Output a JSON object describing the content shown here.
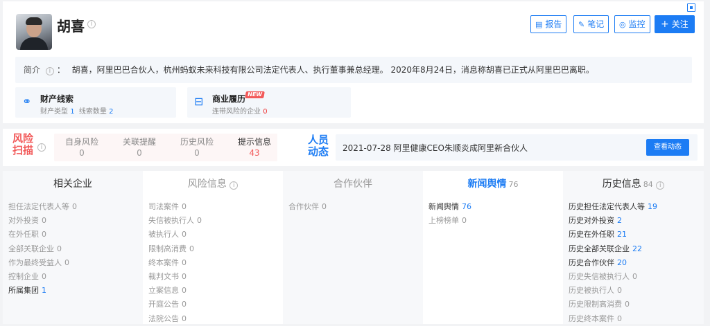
{
  "person": {
    "name": "胡喜"
  },
  "actions": {
    "report": "报告",
    "notes": "笔记",
    "monitor": "监控",
    "follow": "关注"
  },
  "intro": {
    "label": "简介",
    "text": "胡喜，阿里巴巴合伙人，杭州蚂蚁未来科技有限公司法定代表人、执行董事兼总经理。 2020年8月24日，消息称胡喜已正式从阿里巴巴离职。"
  },
  "cards": [
    {
      "title": "财产线索",
      "sub1_label": "财产类型",
      "sub1_value": "1",
      "sub2_label": "线索数量",
      "sub2_value": "2",
      "icon": "link-icon"
    },
    {
      "title": "商业履历",
      "badge": "NEW",
      "sub_label": "连带风险的企业",
      "sub_value": "0",
      "icon": "briefcase-icon"
    }
  ],
  "risk": {
    "title_line1": "风险",
    "title_line2": "扫描",
    "items": [
      {
        "label": "自身风险",
        "value": "0"
      },
      {
        "label": "关联提醒",
        "value": "0"
      },
      {
        "label": "历史风险",
        "value": "0"
      },
      {
        "label": "提示信息",
        "value": "43"
      }
    ]
  },
  "dynamics": {
    "title_line1": "人员",
    "title_line2": "动态",
    "text": "2021-07-28 阿里健康CEO朱顺炎成阿里新合伙人",
    "button": "查看动态"
  },
  "tabs": [
    {
      "label": "相关企业",
      "count": "",
      "rows": [
        {
          "label": "担任法定代表人等",
          "value": "0"
        },
        {
          "label": "对外投资",
          "value": "0"
        },
        {
          "label": "在外任职",
          "value": "0"
        },
        {
          "label": "全部关联企业",
          "value": "0"
        },
        {
          "label": "作为最终受益人",
          "value": "0"
        },
        {
          "label": "控制企业",
          "value": "0"
        },
        {
          "label": "所属集团",
          "value": "1"
        }
      ]
    },
    {
      "label": "风险信息",
      "count": "",
      "rows": [
        {
          "label": "司法案件",
          "value": "0"
        },
        {
          "label": "失信被执行人",
          "value": "0"
        },
        {
          "label": "被执行人",
          "value": "0"
        },
        {
          "label": "限制高消费",
          "value": "0"
        },
        {
          "label": "终本案件",
          "value": "0"
        },
        {
          "label": "裁判文书",
          "value": "0"
        },
        {
          "label": "立案信息",
          "value": "0"
        },
        {
          "label": "开庭公告",
          "value": "0"
        },
        {
          "label": "法院公告",
          "value": "0"
        }
      ]
    },
    {
      "label": "合作伙伴",
      "count": "",
      "rows": [
        {
          "label": "合作伙伴",
          "value": "0"
        }
      ]
    },
    {
      "label": "新闻舆情",
      "count": "76",
      "rows": [
        {
          "label": "新闻舆情",
          "value": "76"
        },
        {
          "label": "上榜榜单",
          "value": "0"
        }
      ]
    },
    {
      "label": "历史信息",
      "count": "84",
      "rows": [
        {
          "label": "历史担任法定代表人等",
          "value": "19"
        },
        {
          "label": "历史对外投资",
          "value": "2"
        },
        {
          "label": "历史在外任职",
          "value": "21"
        },
        {
          "label": "历史全部关联企业",
          "value": "22"
        },
        {
          "label": "历史合作伙伴",
          "value": "20"
        },
        {
          "label": "历史失信被执行人",
          "value": "0"
        },
        {
          "label": "历史被执行人",
          "value": "0"
        },
        {
          "label": "历史限制高消费",
          "value": "0"
        },
        {
          "label": "历史终本案件",
          "value": "0"
        }
      ]
    }
  ]
}
